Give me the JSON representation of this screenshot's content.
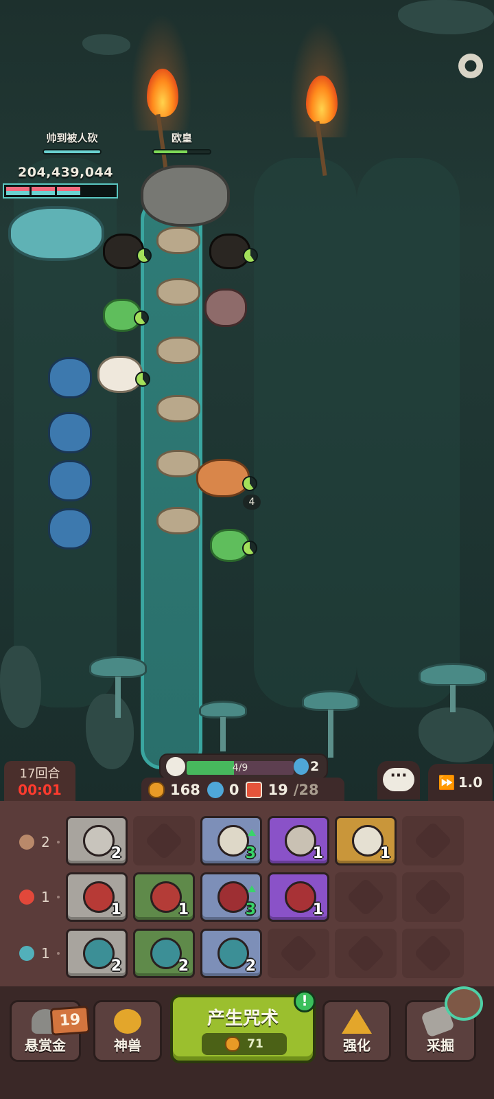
{
  "players": {
    "left": {
      "name": "帅到被人砍",
      "score": "204,439,044"
    },
    "right": {
      "name": "欧皇"
    }
  },
  "battle": {
    "stack_count": "4"
  },
  "hud": {
    "round": "17回合",
    "timer": "00:01",
    "wave_progress": "4/9",
    "wave_fraction": 0.44,
    "skull_gems": "2",
    "gold": "168",
    "souls": "0",
    "cards": "19",
    "cards_max": "/28",
    "speed": "1.0",
    "chat_glyph": "···"
  },
  "elements": [
    {
      "name": "rock",
      "count": "2",
      "color": "#b9896a"
    },
    {
      "name": "fire",
      "count": "1",
      "color": "#e2483a"
    },
    {
      "name": "water",
      "count": "1",
      "color": "#52b0ba"
    }
  ],
  "spell_grid": {
    "row0": [
      {
        "level": "2",
        "bg": "grey",
        "emblem": "#c8c4bc",
        "upgrade": false
      },
      {
        "level": "",
        "bg": "empty"
      },
      {
        "level": "3",
        "bg": "blue",
        "emblem": "#ded8c8",
        "upgrade": true
      },
      {
        "level": "1",
        "bg": "purple",
        "emblem": "#c9c1b3",
        "upgrade": false
      },
      {
        "level": "1",
        "bg": "gold",
        "emblem": "#e5e0d2",
        "upgrade": false
      },
      {
        "level": "",
        "bg": "empty"
      }
    ],
    "row1": [
      {
        "level": "1",
        "bg": "grey",
        "emblem": "#b73a36",
        "upgrade": false
      },
      {
        "level": "1",
        "bg": "green",
        "emblem": "#b43c37",
        "upgrade": false
      },
      {
        "level": "3",
        "bg": "blue",
        "emblem": "#9e2f33",
        "upgrade": true
      },
      {
        "level": "1",
        "bg": "purple",
        "emblem": "#a83236",
        "upgrade": false
      },
      {
        "level": "",
        "bg": "empty"
      },
      {
        "level": "",
        "bg": "empty"
      }
    ],
    "row2": [
      {
        "level": "2",
        "bg": "grey",
        "emblem": "#3c8f96",
        "upgrade": false
      },
      {
        "level": "2",
        "bg": "green",
        "emblem": "#3c8f96",
        "upgrade": false
      },
      {
        "level": "2",
        "bg": "blue",
        "emblem": "#3c8f96",
        "upgrade": false
      },
      {
        "level": "",
        "bg": "empty"
      },
      {
        "level": "",
        "bg": "empty"
      },
      {
        "level": "",
        "bg": "empty"
      }
    ]
  },
  "nav": {
    "bounty": "悬赏金",
    "bounty_badge": "19",
    "beast": "神兽",
    "cast": "产生咒术",
    "cast_cost": "71",
    "cast_alert": "!",
    "upgrade": "强化",
    "mine": "采掘"
  },
  "colors": {
    "accent_green": "#9bbf2e",
    "timer_red": "#ff3b2e",
    "hp_bar": "#6ad1d0"
  }
}
